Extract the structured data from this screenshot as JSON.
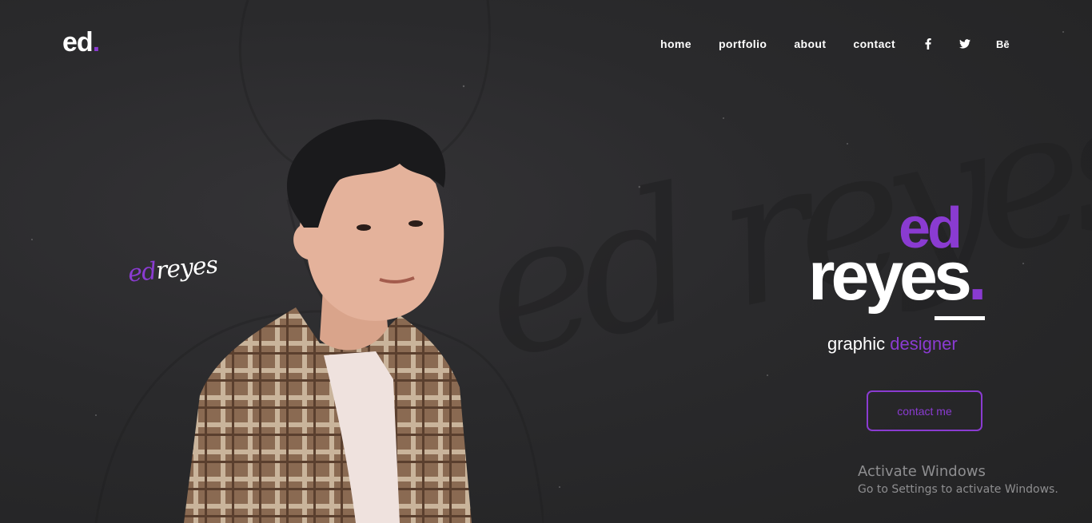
{
  "header": {
    "logo_text": "ed",
    "logo_dot": ".",
    "nav": {
      "home": "home",
      "portfolio": "portfolio",
      "about": "about",
      "contact": "contact",
      "behance": "Bē"
    },
    "social_icons": [
      "facebook-icon",
      "twitter-icon",
      "behance-icon"
    ]
  },
  "signature": {
    "first": "ed",
    "last": "reyes"
  },
  "hero": {
    "first_name": "ed",
    "last_name": "reyes",
    "last_dot": ".",
    "role_first": "graphic",
    "role_accent": "designer",
    "cta": "contact me"
  },
  "watermark": {
    "title": "Activate Windows",
    "subtitle": "Go to Settings to activate Windows."
  },
  "colors": {
    "accent": "#8a3bd1",
    "background": "#272728",
    "text": "#ffffff"
  }
}
